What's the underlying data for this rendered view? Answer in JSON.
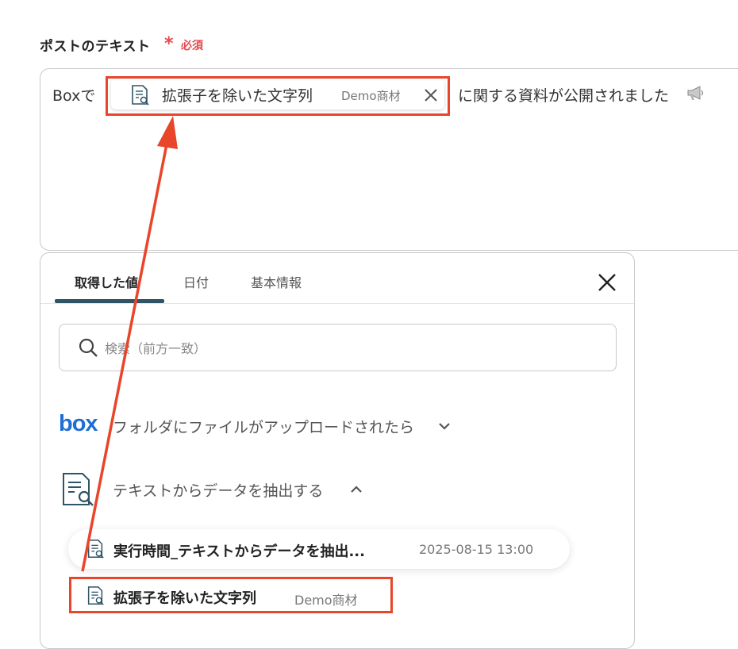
{
  "field": {
    "label": "ポストのテキスト",
    "required_mark": "*",
    "required_text": "必須"
  },
  "textarea": {
    "prefix": "Boxで",
    "suffix": "に関する資料が公開されました",
    "chip": {
      "text": "拡張子を除いた文字列",
      "sub": "Demo商材",
      "icon": "document-search-icon"
    }
  },
  "panel": {
    "tabs": [
      {
        "label": "取得した値",
        "active": true
      },
      {
        "label": "日付",
        "active": false
      },
      {
        "label": "基本情報",
        "active": false
      }
    ],
    "search": {
      "placeholder": "検索（前方一致）",
      "value": ""
    },
    "groups": [
      {
        "logo": "box",
        "title": "フォルダにファイルがアップロードされたら",
        "chevron": "chevron-down-icon"
      },
      {
        "icon": "document-search-icon",
        "title": "テキストからデータを抽出する",
        "chevron": "chevron-up-icon"
      }
    ],
    "rows": [
      {
        "title": "実行時間_テキストからデータを抽出...",
        "meta": "2025-08-15 13:00"
      },
      {
        "title": "拡張子を除いた文字列",
        "meta": "Demo商材"
      }
    ]
  },
  "colors": {
    "accent_red": "#e8452b",
    "required_red": "#e5484d",
    "tab_underline": "#2f5466",
    "box_blue": "#1f6ed4"
  }
}
